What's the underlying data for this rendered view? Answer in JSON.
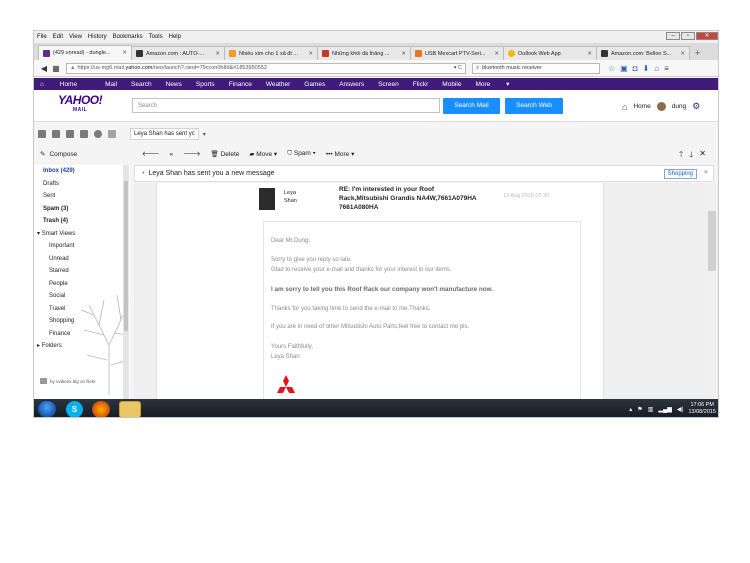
{
  "firefox": {
    "menu": [
      "File",
      "Edit",
      "View",
      "History",
      "Bookmarks",
      "Tools",
      "Help"
    ],
    "tabs": [
      {
        "label": "(429 unread) - dungle...",
        "color": "#5c2d91",
        "active": true
      },
      {
        "label": "Amazon.com : AUTO-...",
        "color": "#333333",
        "active": false
      },
      {
        "label": "Nhiều xim cho 1 xã đt ...",
        "color": "#f29b2b",
        "active": false
      },
      {
        "label": "Những khối đá thắng ...",
        "color": "#c0392b",
        "active": false
      },
      {
        "label": "USB Mexcart PTV-Seri...",
        "color": "#e87522",
        "active": false
      },
      {
        "label": "Outlook Web App",
        "color": "#f5b800",
        "active": false
      },
      {
        "label": "Amazon.com: Bellon S...",
        "color": "#333333",
        "active": false
      }
    ],
    "url_prefix": "https://us-mg6.mail.",
    "url_domain": "yahoo.com",
    "url_suffix": "/neo/launch?.rand=79ccon0h8d&#1853950552",
    "search_value": "bluetooth music receiver"
  },
  "yahoo_nav": [
    "Home",
    "Mail",
    "Search",
    "News",
    "Sports",
    "Finance",
    "Weather",
    "Games",
    "Answers",
    "Screen",
    "Flickr",
    "Mobile",
    "More"
  ],
  "header": {
    "logo": "YAHOO!",
    "logo_sub": "MAIL",
    "search_placeholder": "Search",
    "search_mail": "Search Mail",
    "search_web": "Search Web",
    "home": "Home",
    "user": "dung"
  },
  "toolbar": {
    "tab_title": "Leya Shan has sent yc",
    "compose": "Compose",
    "delete": "Delete",
    "move": "Move",
    "spam": "Spam",
    "more": "More"
  },
  "sidebar": {
    "items": [
      {
        "label": "Inbox (429)",
        "style": "blue"
      },
      {
        "label": "Drafts",
        "style": ""
      },
      {
        "label": "Sent",
        "style": ""
      },
      {
        "label": "Spam (3)",
        "style": "b"
      },
      {
        "label": "Trash (4)",
        "style": "b"
      },
      {
        "label": "Smart Views",
        "style": ""
      },
      {
        "label": "Important",
        "style": "sub"
      },
      {
        "label": "Unread",
        "style": "sub"
      },
      {
        "label": "Starred",
        "style": "sub"
      },
      {
        "label": "People",
        "style": "sub"
      },
      {
        "label": "Social",
        "style": "sub"
      },
      {
        "label": "Travel",
        "style": "sub"
      },
      {
        "label": "Shopping",
        "style": "sub"
      },
      {
        "label": "Finance",
        "style": "sub"
      },
      {
        "label": "Folders",
        "style": ""
      }
    ],
    "credit": "by nvdienx.blg on flickr"
  },
  "notification": {
    "text": "Leya Shan has sent you a new message",
    "badge": "Shopping"
  },
  "message": {
    "sender_first": "Leya",
    "sender_last": "Shan",
    "subject": "RE: I'm interested in your Roof Rack,Mitsubishi Grandis NA4W,7661A079HA 7661A080HA",
    "date": "13 Aug 2015 02:30",
    "body": [
      {
        "text": "Dear Mr.Dung,",
        "strong": false
      },
      {
        "text": "Sorry to give you reply so late.",
        "strong": false
      },
      {
        "text": "Glad to receive your e-mail and thanks for your interest in our items.",
        "strong": false
      },
      {
        "text": "I am sorry to tell you this Roof Rack our company won't manufacture now.",
        "strong": true
      },
      {
        "text": "Thanks for you taking time to send the e-mail to me.Thanks.",
        "strong": false
      },
      {
        "text": "If you are in need of other Mitsubishi Auto Parts,feel free to contact me pls.",
        "strong": false
      },
      {
        "text": "Yours Faithfully,",
        "strong": false
      },
      {
        "text": "Leya Shan",
        "strong": false
      }
    ]
  },
  "taskbar": {
    "time": "17:06 PM",
    "date": "13/08/2015"
  }
}
